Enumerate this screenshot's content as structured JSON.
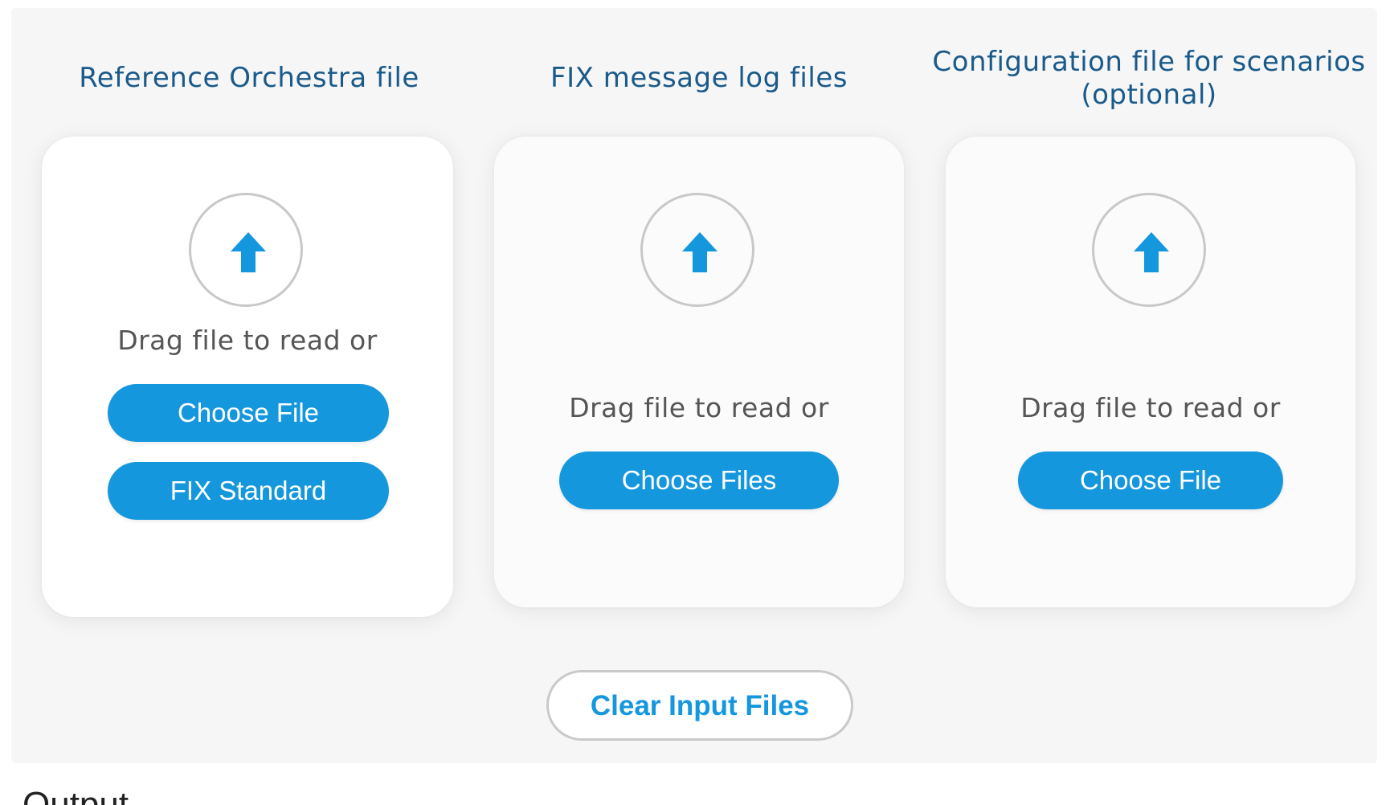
{
  "columns": [
    {
      "title_lines": [
        "Reference Orchestra file"
      ],
      "drag_text": "Drag file to read or",
      "buttons": [
        "Choose File",
        "FIX Standard"
      ]
    },
    {
      "title_lines": [
        "FIX message log files"
      ],
      "drag_text": "Drag file to read or",
      "buttons": [
        "Choose Files"
      ]
    },
    {
      "title_lines": [
        "Configuration file for scenarios",
        "(optional)"
      ],
      "drag_text": "Drag file to read or",
      "buttons": [
        "Choose File"
      ]
    }
  ],
  "clear_button_label": "Clear Input Files",
  "output_heading": "Output",
  "icons": {
    "upload": "upload-arrow-icon"
  },
  "colors": {
    "accent": "#1597de",
    "title": "#1a5a8a",
    "circle_border": "#c8c8c8"
  }
}
